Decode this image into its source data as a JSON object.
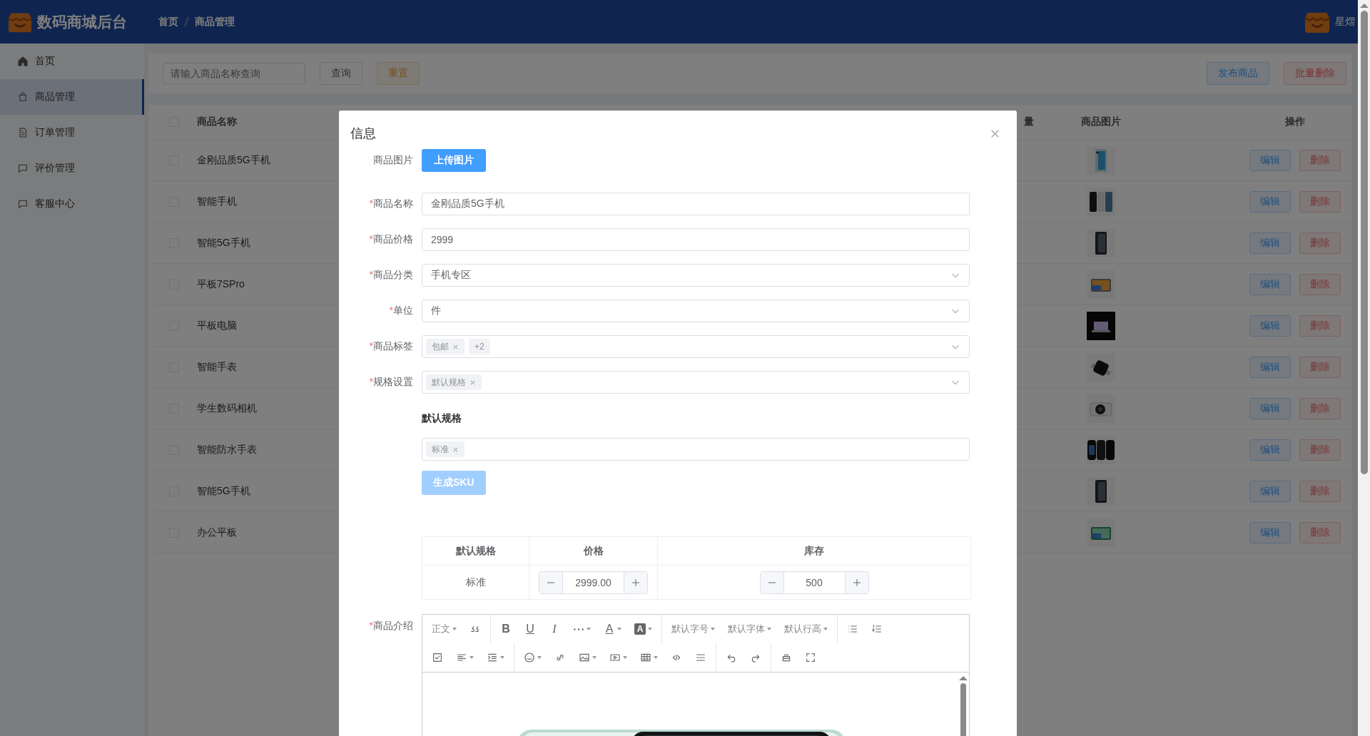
{
  "app": {
    "title": "数码商城后台",
    "breadcrumb": [
      "首页",
      "商品管理"
    ],
    "user_name": "星熠"
  },
  "sidebar": {
    "items": [
      {
        "label": "首页",
        "selected": false
      },
      {
        "label": "商品管理",
        "selected": true
      },
      {
        "label": "订单管理",
        "selected": false
      },
      {
        "label": "评价管理",
        "selected": false
      },
      {
        "label": "客服中心",
        "selected": false
      }
    ]
  },
  "filter": {
    "search_placeholder": "请输入商品名称查询",
    "buttons": [
      {
        "label": "查询",
        "kind": "default"
      },
      {
        "label": "重置",
        "kind": "warning"
      }
    ],
    "actions": [
      {
        "label": "发布商品",
        "kind": "primary"
      },
      {
        "label": "批量删除",
        "kind": "danger"
      }
    ]
  },
  "table": {
    "select_all_checked": false,
    "columns": [
      "商品名称",
      "量",
      "商品图片",
      "操作"
    ],
    "rows": [
      {
        "name": "金刚品质5G手机",
        "checked": false,
        "actions": [
          "编辑",
          "删除"
        ]
      },
      {
        "name": "智能手机",
        "checked": false,
        "actions": [
          "编辑",
          "删除"
        ]
      },
      {
        "name": "智能5G手机",
        "checked": false,
        "actions": [
          "编辑",
          "删除"
        ]
      },
      {
        "name": "平板7SPro",
        "checked": false,
        "actions": [
          "编辑",
          "删除"
        ]
      },
      {
        "name": "平板电脑",
        "checked": false,
        "actions": [
          "编辑",
          "删除"
        ]
      },
      {
        "name": "智能手表",
        "checked": false,
        "actions": [
          "编辑",
          "删除"
        ]
      },
      {
        "name": "学生数码相机",
        "checked": false,
        "actions": [
          "编辑",
          "删除"
        ]
      },
      {
        "name": "智能防水手表",
        "checked": false,
        "actions": [
          "编辑",
          "删除"
        ]
      },
      {
        "name": "智能5G手机",
        "checked": false,
        "actions": [
          "编辑",
          "删除"
        ]
      },
      {
        "name": "办公平板",
        "checked": false,
        "actions": [
          "编辑",
          "删除"
        ]
      }
    ]
  },
  "dialog": {
    "title": "信息",
    "required_mark": "*",
    "fields": [
      {
        "label": "商品图片",
        "required": false,
        "kind": "upload",
        "button": "上传图片"
      },
      {
        "label": "商品名称",
        "required": true,
        "kind": "input",
        "value": "金刚品质5G手机"
      },
      {
        "label": "商品价格",
        "required": true,
        "kind": "input",
        "value": "2999"
      },
      {
        "label": "商品分类",
        "required": true,
        "kind": "select",
        "value": "手机专区"
      },
      {
        "label": "单位",
        "required": true,
        "kind": "select",
        "value": "件"
      },
      {
        "label": "商品标签",
        "required": true,
        "kind": "tags",
        "tags": [
          "包邮"
        ],
        "more": "+2"
      },
      {
        "label": "规格设置",
        "required": true,
        "kind": "tags",
        "tags": [
          "默认规格"
        ]
      }
    ],
    "spec_group": {
      "title": "默认规格",
      "tags": [
        "标准"
      ]
    },
    "sku_button": {
      "label": "生成SKU",
      "disabled": true
    },
    "sku_table": {
      "columns": [
        "默认规格",
        "价格",
        "库存"
      ],
      "rows": [
        {
          "spec": "标准",
          "price": "2999.00",
          "stock": "500"
        }
      ]
    },
    "editor": {
      "label": "商品介绍",
      "required": true,
      "dropdowns": [
        "正文",
        "默认字号",
        "默认字体",
        "默认行高"
      ],
      "glyphs": [
        "B",
        "U",
        "I",
        "A",
        "A"
      ]
    }
  }
}
